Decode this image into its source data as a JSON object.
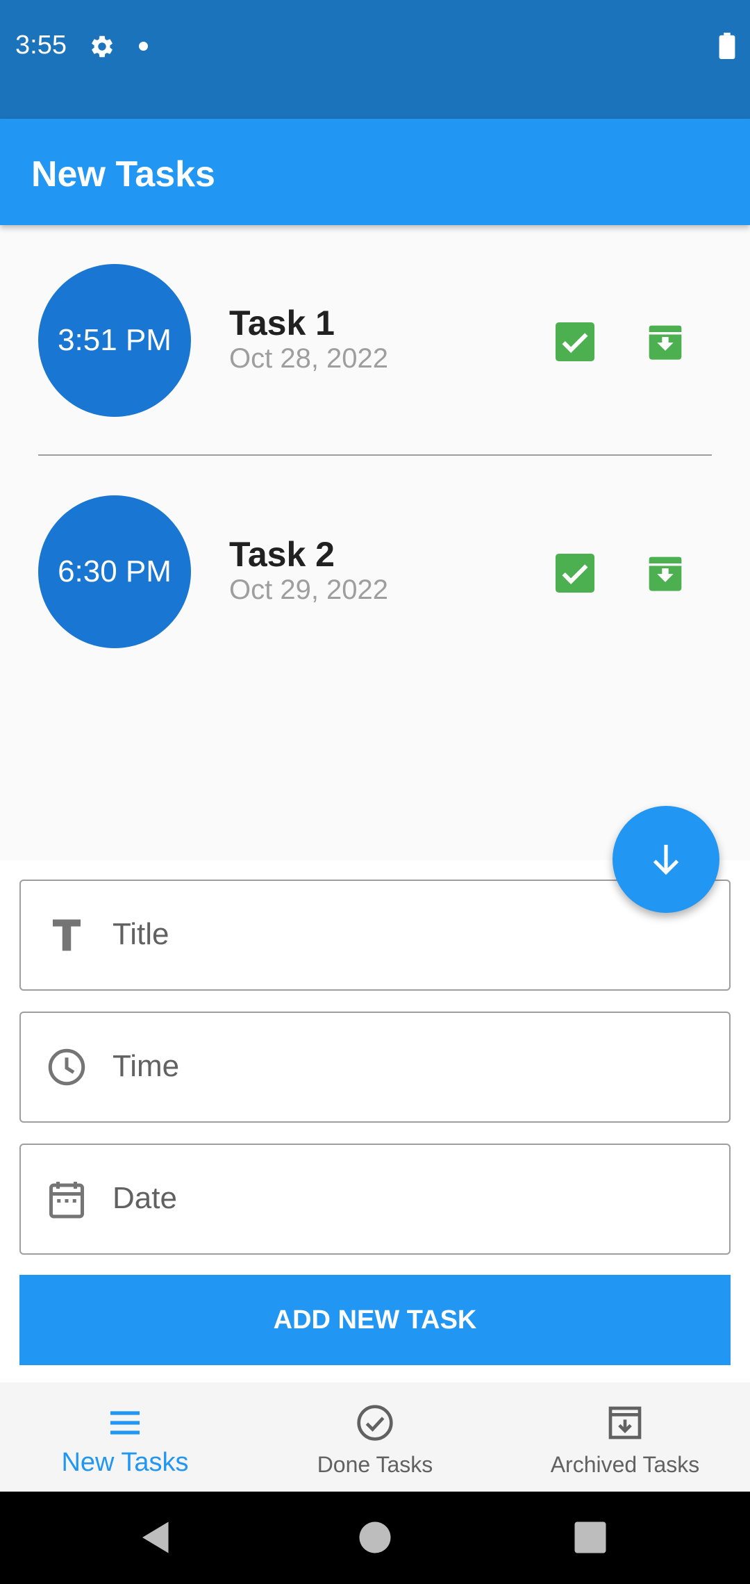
{
  "status_bar": {
    "time": "3:55"
  },
  "app_bar": {
    "title": "New Tasks"
  },
  "tasks": [
    {
      "time": "3:51 PM",
      "title": "Task 1",
      "date": "Oct 28, 2022"
    },
    {
      "time": "6:30 PM",
      "title": "Task 2",
      "date": "Oct 29, 2022"
    }
  ],
  "form": {
    "title_placeholder": "Title",
    "time_placeholder": "Time",
    "date_placeholder": "Date",
    "submit_label": "ADD NEW TASK"
  },
  "bottom_nav": {
    "items": [
      {
        "label": "New Tasks",
        "icon": "menu-icon",
        "active": true
      },
      {
        "label": "Done Tasks",
        "icon": "check-circle-icon",
        "active": false
      },
      {
        "label": "Archived Tasks",
        "icon": "archive-icon",
        "active": false
      }
    ]
  },
  "colors": {
    "status_bar": "#1b73bb",
    "app_bar": "#2196f3",
    "time_circle": "#1976d2",
    "action_green": "#4caf50",
    "accent": "#2196f3"
  }
}
